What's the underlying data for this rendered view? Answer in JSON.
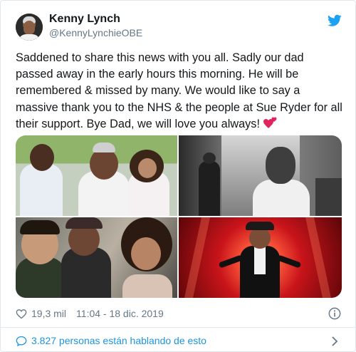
{
  "author": {
    "name": "Kenny Lynch",
    "handle": "@KennyLynchieOBE"
  },
  "tweet_text": "Saddened to share this news with you all. Sadly our dad passed away in the early hours this morning. He will be remembered & missed by many. We would like to say a massive thank you to the NHS & the people at Sue Ryder for all their support. Bye Dad, we will love you always!",
  "footer": {
    "likes": "19,3 mil",
    "timestamp": "11:04 - 18 dic. 2019"
  },
  "conversation": {
    "label": "3.827 personas están hablando de esto"
  },
  "colors": {
    "twitter_blue": "#1da1f2",
    "link_blue": "#1b95e0",
    "secondary_text": "#657786",
    "heart_emoji": "#e0245e"
  },
  "icons": [
    "twitter-bird-icon",
    "heart-icon",
    "info-icon",
    "comment-icon",
    "chevron-right-icon",
    "two-hearts-emoji"
  ]
}
